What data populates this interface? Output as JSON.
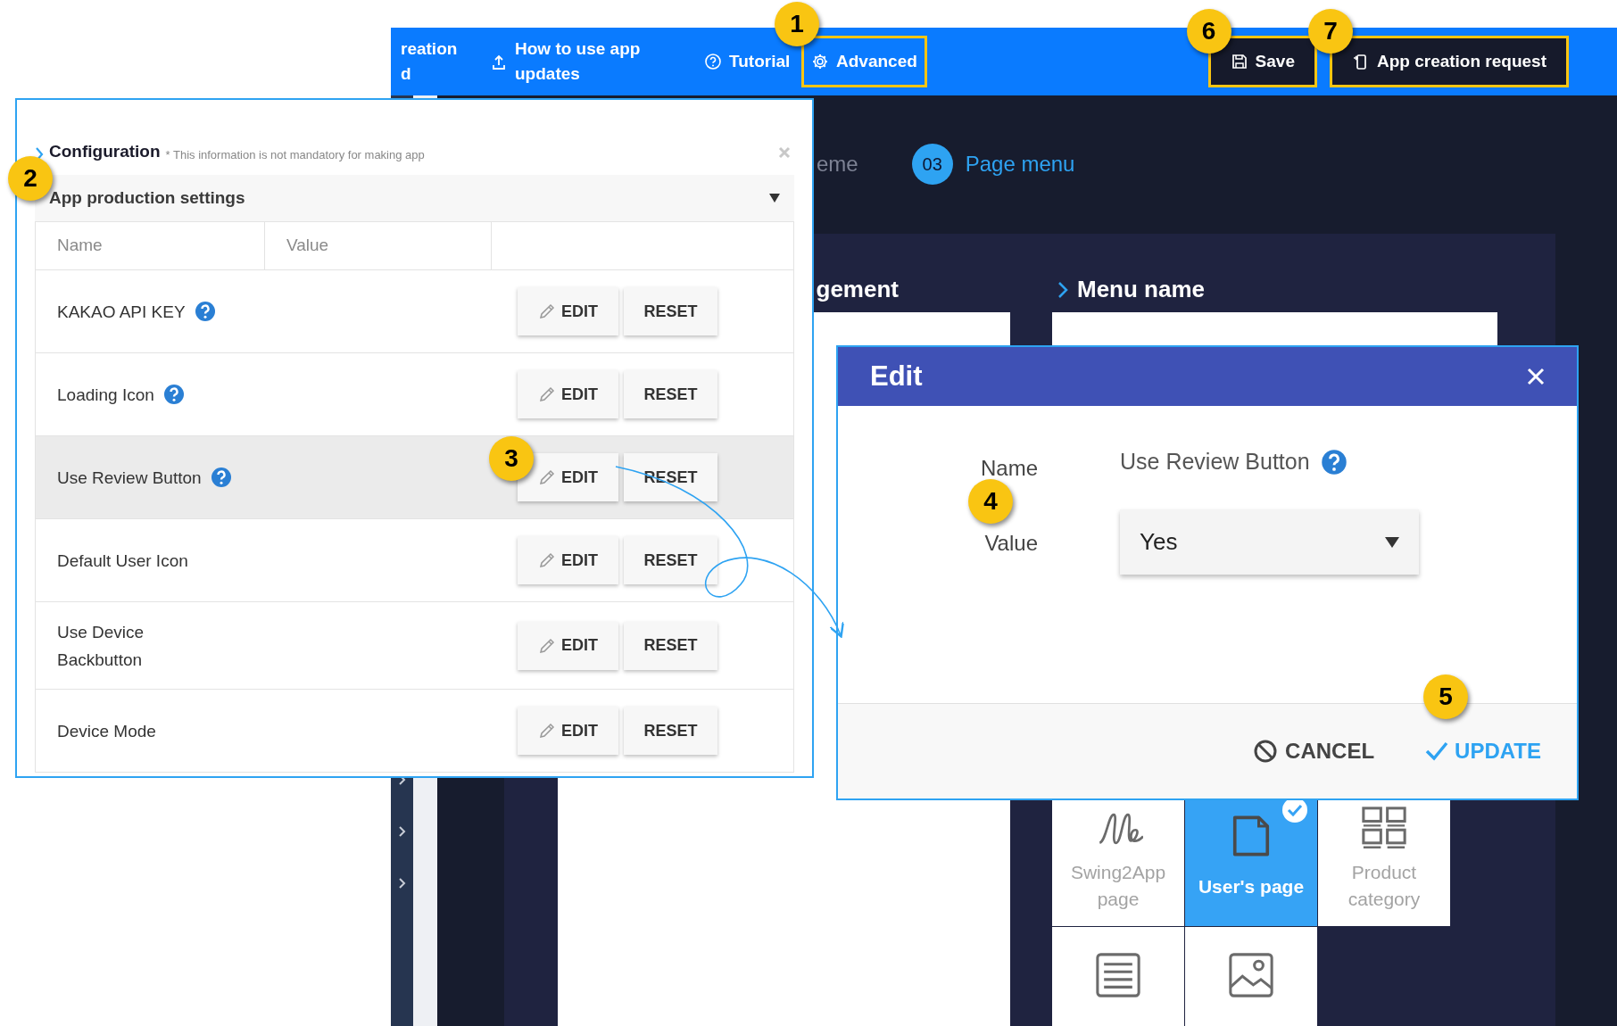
{
  "top_bar": {
    "links": [
      {
        "label": "reation\nd",
        "kind": "plain",
        "highlighted": false
      },
      {
        "label": "How to use app\nupdates",
        "kind": "upload",
        "highlighted": false
      },
      {
        "label": "Tutorial",
        "kind": "help",
        "highlighted": false
      },
      {
        "label": "Advanced",
        "kind": "gear",
        "highlighted": true,
        "callout": "1"
      }
    ],
    "actions": [
      {
        "label": "Save",
        "kind": "floppy",
        "highlighted": true,
        "callout": "6"
      },
      {
        "label": "App creation request",
        "kind": "phone",
        "highlighted": true,
        "callout": "7"
      }
    ]
  },
  "steps": [
    {
      "label": "eme",
      "selected": false
    },
    {
      "number": "03",
      "label": "Page menu",
      "selected": true
    }
  ],
  "section_headings": [
    "gement",
    "Menu name"
  ],
  "page_tiles": [
    {
      "label": "Swing2App page",
      "kind": "signature",
      "selected": false
    },
    {
      "label": "User's page",
      "kind": "page",
      "selected": true
    },
    {
      "label": "Product category",
      "kind": "grid",
      "selected": false
    },
    {
      "kind": "list",
      "selected": false
    },
    {
      "kind": "image",
      "selected": false
    }
  ],
  "config_panel": {
    "title": "Configuration",
    "note": "* This information is not mandatory for making app",
    "callout": "2",
    "section": {
      "title": "App production settings",
      "expanded": true
    },
    "columns": [
      "Name",
      "Value"
    ],
    "rows": [
      {
        "name": "KAKAO API KEY",
        "help": true,
        "selected": false,
        "edit_label": "EDIT",
        "reset_label": "RESET"
      },
      {
        "name": "Loading Icon",
        "help": true,
        "selected": false,
        "edit_label": "EDIT",
        "reset_label": "RESET"
      },
      {
        "name": "Use Review Button",
        "help": true,
        "selected": true,
        "callout": "3",
        "edit_label": "EDIT",
        "reset_label": "RESET"
      },
      {
        "name": "Default User Icon",
        "help": false,
        "selected": false,
        "edit_label": "EDIT",
        "reset_label": "RESET"
      },
      {
        "name": "Use Device\nBackbutton",
        "help": false,
        "selected": false,
        "edit_label": "EDIT",
        "reset_label": "RESET"
      },
      {
        "name": "Device Mode",
        "help": false,
        "selected": false,
        "edit_label": "EDIT",
        "reset_label": "RESET"
      }
    ]
  },
  "edit_dialog": {
    "title": "Edit",
    "name_label": "Name",
    "name_value": "Use Review Button",
    "value_label": "Value",
    "value": "Yes",
    "value_callout": "4",
    "cancel": "CANCEL",
    "update": "UPDATE",
    "update_callout": "5"
  }
}
